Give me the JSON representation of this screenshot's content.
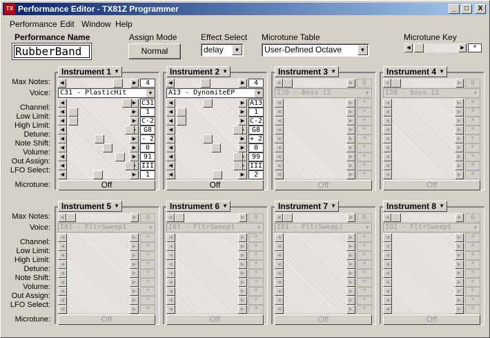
{
  "window": {
    "app_icon": "TX",
    "title": "Performance Editor - TX81Z Programmer",
    "minimize": "_",
    "maximize": "□",
    "close": "X"
  },
  "menu": [
    "Performance",
    "Edit",
    "Window",
    "Help"
  ],
  "performance_name_label": "Performance Name",
  "performance_name": "RubberBand",
  "assign_mode": {
    "label": "Assign Mode",
    "value": "Normal"
  },
  "effect_select": {
    "label": "Effect Select",
    "value": "delay"
  },
  "microtune_table": {
    "label": "Microtune Table",
    "value": "User-Defined Octave"
  },
  "microtune_key": {
    "label": "Microtune Key",
    "value": "*"
  },
  "row_labels": [
    "Max Notes:",
    "Voice:",
    "Channel:",
    "Low Limit:",
    "High Limit:",
    "Detune:",
    "Note Shift:",
    "Volume:",
    "Out Assign:",
    "LFO Select:",
    "Microtune:"
  ],
  "instruments": [
    {
      "name": "Instrument 1",
      "enabled": true,
      "max_notes": "4",
      "voice": "C31 - PlasticHit",
      "values": [
        "C31",
        "1",
        "C-2",
        "G8",
        "- 2",
        "0",
        "91",
        "III",
        "1"
      ],
      "microtune": "Off"
    },
    {
      "name": "Instrument 2",
      "enabled": true,
      "max_notes": "4",
      "voice": "A13 - DynomiteEP",
      "values": [
        "A13",
        "1",
        "C-2",
        "G8",
        "+ 2",
        "0",
        "99",
        "III",
        "2"
      ],
      "microtune": "Off"
    },
    {
      "name": "Instrument 3",
      "enabled": false,
      "max_notes": "0",
      "voice": "I28 - Bass 12",
      "values": [
        "*",
        "*",
        "*",
        "*",
        "*",
        "*",
        "*",
        "*",
        "*"
      ],
      "microtune": "Off"
    },
    {
      "name": "Instrument 4",
      "enabled": false,
      "max_notes": "0",
      "voice": "I28 - Bass 12",
      "values": [
        "*",
        "*",
        "*",
        "*",
        "*",
        "*",
        "*",
        "*",
        "*"
      ],
      "microtune": "Off"
    },
    {
      "name": "Instrument 5",
      "enabled": false,
      "max_notes": "0",
      "voice": "I01 - FltrSweep1",
      "values": [
        "*",
        "*",
        "*",
        "*",
        "*",
        "*",
        "*",
        "*",
        "*"
      ],
      "microtune": "Off"
    },
    {
      "name": "Instrument 6",
      "enabled": false,
      "max_notes": "0",
      "voice": "I01 - FltrSweep1",
      "values": [
        "*",
        "*",
        "*",
        "*",
        "*",
        "*",
        "*",
        "*",
        "*"
      ],
      "microtune": "Off"
    },
    {
      "name": "Instrument 7",
      "enabled": false,
      "max_notes": "0",
      "voice": "I01 - FltrSweep1",
      "values": [
        "*",
        "*",
        "*",
        "*",
        "*",
        "*",
        "*",
        "*",
        "*"
      ],
      "microtune": "Off"
    },
    {
      "name": "Instrument 8",
      "enabled": false,
      "max_notes": "0",
      "voice": "I01 - FltrSweep1",
      "values": [
        "*",
        "*",
        "*",
        "*",
        "*",
        "*",
        "*",
        "*",
        "*"
      ],
      "microtune": "Off"
    }
  ]
}
